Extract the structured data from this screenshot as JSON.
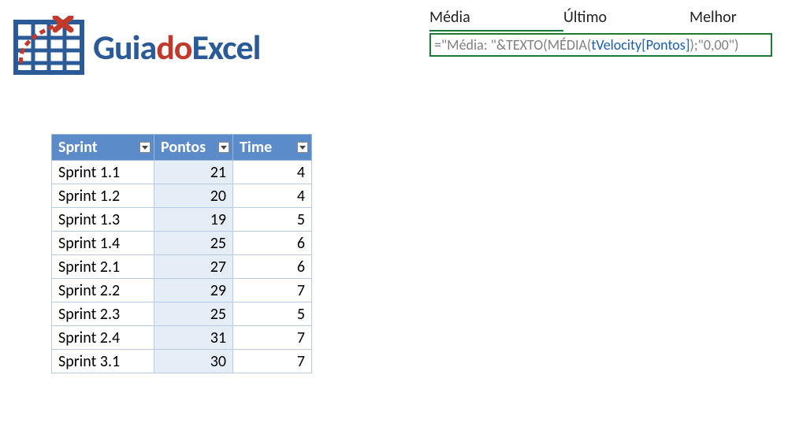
{
  "logo": {
    "guia": "Guia",
    "do": "do",
    "excel": "Excel"
  },
  "headers": {
    "media": "Média",
    "ultimo": "Último",
    "melhor": "Melhor"
  },
  "formula": {
    "prefix": "=\"Média: \"&",
    "fn1": "TEXTO",
    "open1": "(",
    "fn2": "MÉDIA",
    "open2": "(",
    "ref": "tVelocity[Pontos]",
    "close2": ")",
    "sep": ";",
    "fmt": "\"0,00\"",
    "close1": ")"
  },
  "table": {
    "columns": {
      "sprint": "Sprint",
      "pontos": "Pontos",
      "time": "Time"
    },
    "rows": [
      {
        "sprint": "Sprint 1.1",
        "pontos": 21,
        "time": 4
      },
      {
        "sprint": "Sprint 1.2",
        "pontos": 20,
        "time": 4
      },
      {
        "sprint": "Sprint 1.3",
        "pontos": 19,
        "time": 5
      },
      {
        "sprint": "Sprint 1.4",
        "pontos": 25,
        "time": 6
      },
      {
        "sprint": "Sprint 2.1",
        "pontos": 27,
        "time": 6
      },
      {
        "sprint": "Sprint 2.2",
        "pontos": 29,
        "time": 7
      },
      {
        "sprint": "Sprint 2.3",
        "pontos": 25,
        "time": 5
      },
      {
        "sprint": "Sprint 2.4",
        "pontos": 31,
        "time": 7
      },
      {
        "sprint": "Sprint 3.1",
        "pontos": 30,
        "time": 7
      }
    ]
  },
  "chart_data": {
    "type": "table",
    "title": "tVelocity",
    "columns": [
      "Sprint",
      "Pontos",
      "Time"
    ],
    "rows": [
      [
        "Sprint 1.1",
        21,
        4
      ],
      [
        "Sprint 1.2",
        20,
        4
      ],
      [
        "Sprint 1.3",
        19,
        5
      ],
      [
        "Sprint 1.4",
        25,
        6
      ],
      [
        "Sprint 2.1",
        27,
        6
      ],
      [
        "Sprint 2.2",
        29,
        7
      ],
      [
        "Sprint 2.3",
        25,
        5
      ],
      [
        "Sprint 2.4",
        31,
        7
      ],
      [
        "Sprint 3.1",
        30,
        7
      ]
    ]
  }
}
